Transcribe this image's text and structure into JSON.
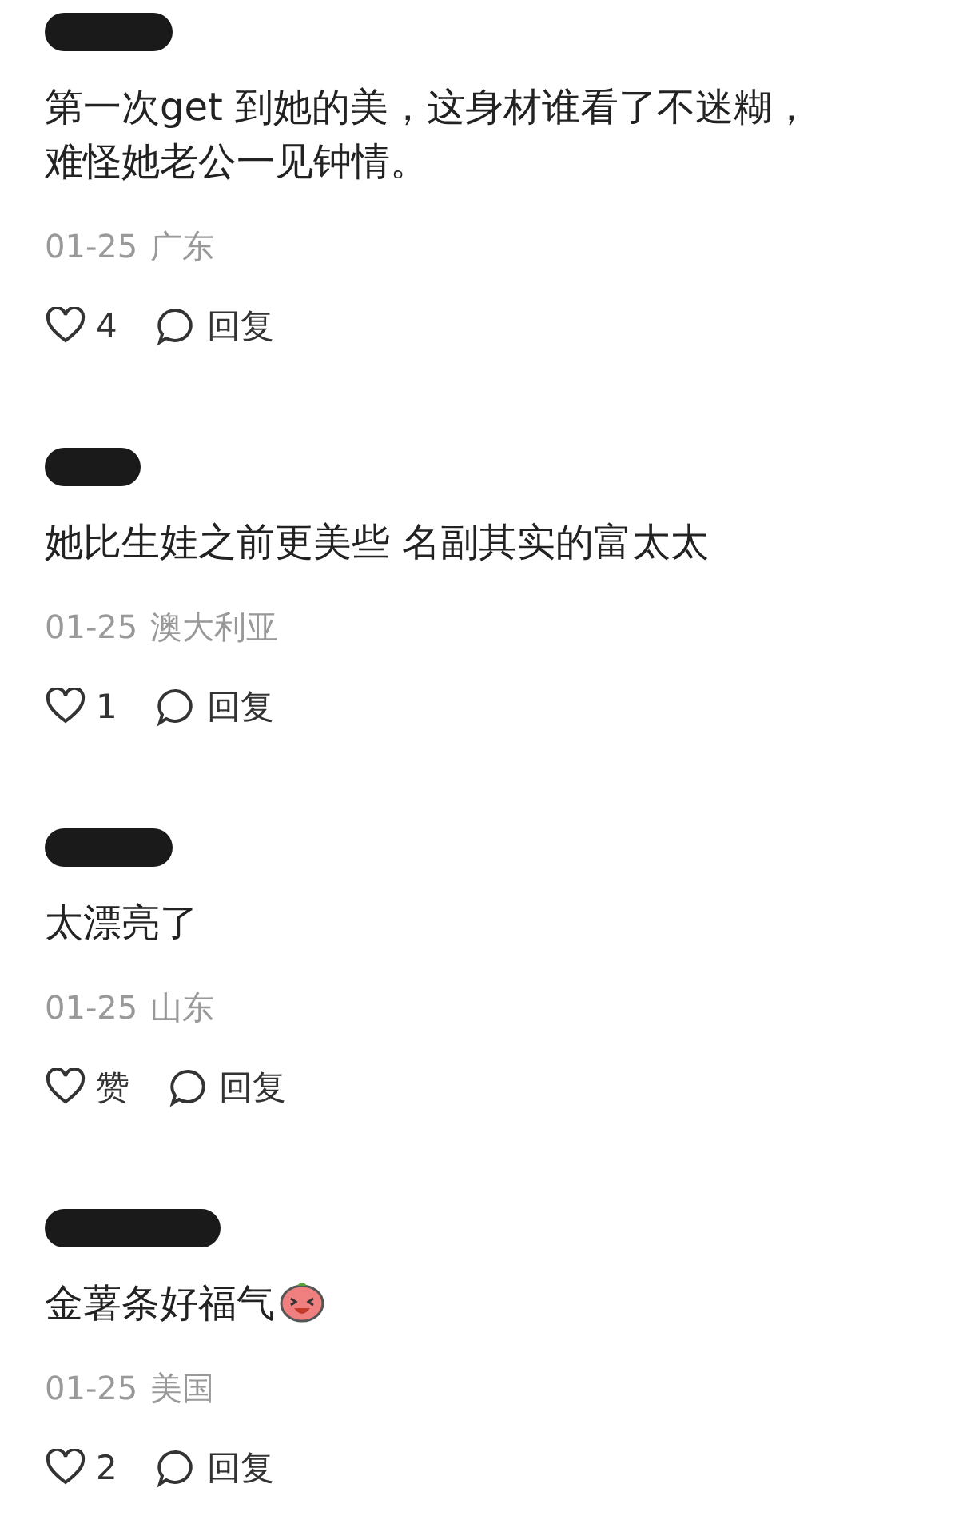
{
  "comments": [
    {
      "name_redacted": true,
      "text": "第一次get 到她的美，这身材谁看了不迷糊，难怪她老公一见钟情。",
      "sticker": false,
      "date": "01-25",
      "location": "广东",
      "likes": "4",
      "reply": "回复"
    },
    {
      "name_redacted": true,
      "text": "她比生娃之前更美些 名副其实的富太太",
      "sticker": false,
      "date": "01-25",
      "location": "澳大利亚",
      "likes": "1",
      "reply": "回复"
    },
    {
      "name_redacted": true,
      "text": "太漂亮了",
      "sticker": false,
      "date": "01-25",
      "location": "山东",
      "likes": "赞",
      "reply": "回复"
    },
    {
      "name_redacted": true,
      "text": "金薯条好福气",
      "sticker": true,
      "date": "01-25",
      "location": "美国",
      "likes": "2",
      "reply": "回复"
    }
  ]
}
